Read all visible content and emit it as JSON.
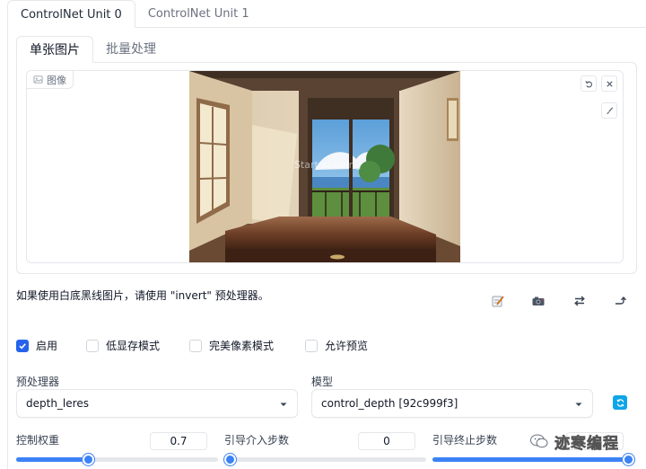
{
  "unit_tabs": [
    {
      "label": "ControlNet Unit 0",
      "active": true
    },
    {
      "label": "ControlNet Unit 1",
      "active": false
    }
  ],
  "image_tabs": [
    {
      "label": "单张图片",
      "active": true
    },
    {
      "label": "批量处理",
      "active": false
    }
  ],
  "image_panel": {
    "label": "图像",
    "overlay_text": "Start drawing"
  },
  "hint_text": "如果使用白底黑线图片，请使用 \"invert\" 预处理器。",
  "checkboxes": [
    {
      "label": "启用",
      "checked": true
    },
    {
      "label": "低显存模式",
      "checked": false
    },
    {
      "label": "完美像素模式",
      "checked": false
    },
    {
      "label": "允许预览",
      "checked": false
    }
  ],
  "preprocessor": {
    "label": "预处理器",
    "value": "depth_leres"
  },
  "model": {
    "label": "模型",
    "value": "control_depth [92c999f3]"
  },
  "sliders": [
    {
      "label": "控制权重",
      "value": "0.7",
      "fraction": 0.35
    },
    {
      "label": "引导介入步数",
      "value": "0",
      "fraction": 0.0
    },
    {
      "label": "引导终止步数",
      "value": "1",
      "fraction": 1.0
    }
  ],
  "watermark": {
    "text": "迹寒编程"
  },
  "colors": {
    "accent": "#3b82f6",
    "checkbox_on": "#2563eb",
    "refresh": "#0ea5e9",
    "border": "#e5e7eb"
  }
}
